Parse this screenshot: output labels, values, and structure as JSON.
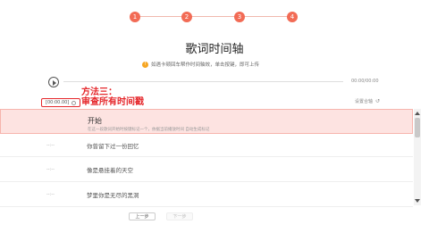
{
  "stepper": {
    "steps": [
      "1",
      "2",
      "3",
      "4"
    ],
    "color": "#f26b55"
  },
  "title": "歌词时间轴",
  "tip": {
    "icon": "info-icon",
    "text": "如遇卡顿回车帮作时间轴效，单击按键，即可上传"
  },
  "player": {
    "play_icon": "play-icon",
    "total_time": "00:00/00:00"
  },
  "annotation": {
    "line1": "方法三：",
    "line2": "审查所有时间戳",
    "color": "#e5262a"
  },
  "current_time": {
    "value": "[00:00.00]",
    "refresh_icon": "refresh-icon"
  },
  "reset": {
    "label": "设置合轴",
    "icon": "undo-icon"
  },
  "lyrics": [
    {
      "time": "",
      "text": "开始",
      "sub": "在这一段歌词开始时按键标记一个，依据当前播放时间 自动生成标记",
      "active": true
    },
    {
      "time": "--:--",
      "text": "你曾留下过一份回忆",
      "active": false
    },
    {
      "time": "--:--",
      "text": "像是悬挂着的天空",
      "active": false
    },
    {
      "time": "--:--",
      "text": "梦里你是无尽的黑洞",
      "active": false
    }
  ],
  "footer": {
    "prev_label": "上一步",
    "next_label": "下一步"
  }
}
